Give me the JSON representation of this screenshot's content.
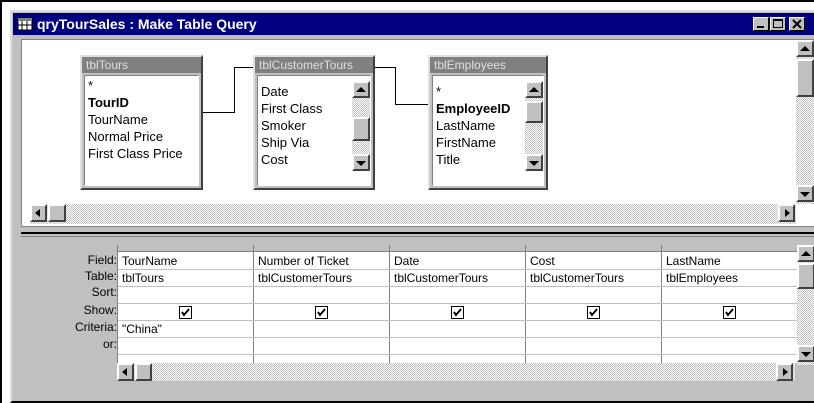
{
  "window": {
    "title": "qryTourSales : Make Table Query"
  },
  "caption_buttons": [
    "minimize",
    "maximize",
    "close"
  ],
  "field_lists": [
    {
      "title": "tblTours",
      "items": [
        {
          "label": "*",
          "bold": false
        },
        {
          "label": "TourID",
          "bold": true
        },
        {
          "label": "TourName",
          "bold": false
        },
        {
          "label": "Normal Price",
          "bold": false
        },
        {
          "label": "First Class Price",
          "bold": false
        }
      ]
    },
    {
      "title": "tblCustomerTours",
      "items": [
        {
          "label": "Date",
          "bold": false
        },
        {
          "label": "First Class",
          "bold": false
        },
        {
          "label": "Smoker",
          "bold": false
        },
        {
          "label": "Ship Via",
          "bold": false
        },
        {
          "label": "Cost",
          "bold": false
        }
      ]
    },
    {
      "title": "tblEmployees",
      "items": [
        {
          "label": "*",
          "bold": false
        },
        {
          "label": "EmployeeID",
          "bold": true
        },
        {
          "label": "LastName",
          "bold": false
        },
        {
          "label": "FirstName",
          "bold": false
        },
        {
          "label": "Title",
          "bold": false
        }
      ]
    }
  ],
  "grid": {
    "row_labels": [
      "Field:",
      "Table:",
      "Sort:",
      "Show:",
      "Criteria:",
      "or:"
    ],
    "columns": [
      {
        "field": "TourName",
        "table": "tblTours",
        "sort": "",
        "show": true,
        "criteria": "\"China\"",
        "or": ""
      },
      {
        "field": "Number of Ticket",
        "table": "tblCustomerTours",
        "sort": "",
        "show": true,
        "criteria": "",
        "or": ""
      },
      {
        "field": "Date",
        "table": "tblCustomerTours",
        "sort": "",
        "show": true,
        "criteria": "",
        "or": ""
      },
      {
        "field": "Cost",
        "table": "tblCustomerTours",
        "sort": "",
        "show": true,
        "criteria": "",
        "or": ""
      },
      {
        "field": "LastName",
        "table": "tblEmployees",
        "sort": "",
        "show": true,
        "criteria": "",
        "or": ""
      }
    ]
  },
  "colors": {
    "title_bar": "#000080",
    "face": "#c0c0c0",
    "field_list_title": "#808080"
  }
}
